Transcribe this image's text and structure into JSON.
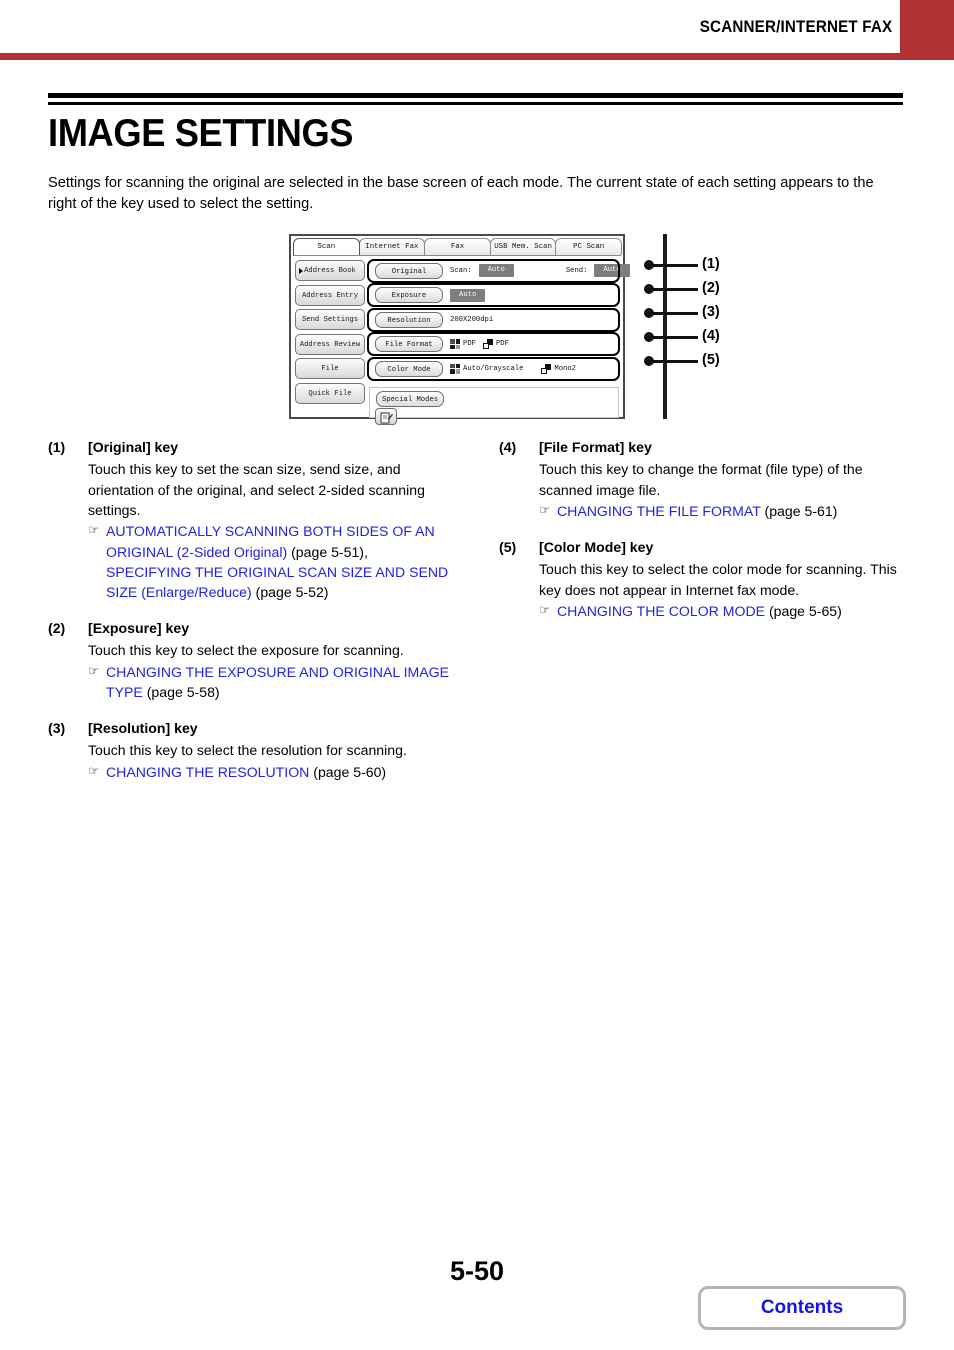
{
  "header": {
    "title": "SCANNER/INTERNET FAX",
    "accent_color": "#b03334"
  },
  "page": {
    "title": "IMAGE SETTINGS",
    "intro": "Settings for scanning the original are selected in the base screen of each mode. The current state of each setting appears to the right of the key used to select the setting.",
    "number": "5-50",
    "contents_label": "Contents",
    "link_color": "#2222e0"
  },
  "figure": {
    "tabs": [
      {
        "label": "Scan",
        "active": true
      },
      {
        "label": "Internet Fax",
        "active": false
      },
      {
        "label": "Fax",
        "active": false
      },
      {
        "label": "USB Mem. Scan",
        "active": false
      },
      {
        "label": "PC Scan",
        "active": false
      }
    ],
    "side_keys": [
      {
        "label": "Address Book",
        "selected": true
      },
      {
        "label": "Address Entry",
        "selected": false
      },
      {
        "label": "Send Settings",
        "selected": false
      },
      {
        "label": "Address Review",
        "selected": false
      },
      {
        "label": "File",
        "selected": false
      },
      {
        "label": "Quick File",
        "selected": false
      }
    ],
    "rows": {
      "original": {
        "key_label": "Original",
        "scan_label": "Scan:",
        "scan_value": "Auto",
        "send_label": "Send:",
        "send_value": "Auto"
      },
      "exposure": {
        "key_label": "Exposure",
        "value": "Auto"
      },
      "resolution": {
        "key_label": "Resolution",
        "value": "200X200dpi"
      },
      "file_format": {
        "key_label": "File Format",
        "color_value": "PDF",
        "mono_value": "PDF"
      },
      "color_mode": {
        "key_label": "Color Mode",
        "color_value": "Auto/Grayscale",
        "mono_value": "Mono2"
      }
    },
    "special_modes_label": "Special Modes",
    "doc_icon_name": "document-edit-icon",
    "callouts": [
      {
        "num": "(1)"
      },
      {
        "num": "(2)"
      },
      {
        "num": "(3)"
      },
      {
        "num": "(4)"
      },
      {
        "num": "(5)"
      }
    ]
  },
  "descriptions": {
    "left": [
      {
        "num": "(1)",
        "title": "[Original] key",
        "body": "Touch this key to set the scan size, send size, and orientation of the original, and select 2-sided scanning settings.",
        "xrefs": [
          {
            "hand": "☞",
            "parts": [
              {
                "text": "AUTOMATICALLY SCANNING BOTH SIDES OF AN ORIGINAL (2-Sided Original) ",
                "link": true
              },
              {
                "text": "(page 5-51), ",
                "link": false
              },
              {
                "text": "SPECIFYING THE ORIGINAL SCAN SIZE AND SEND SIZE (Enlarge/Reduce) ",
                "link": true
              },
              {
                "text": "(page 5-52)",
                "link": false
              }
            ]
          }
        ]
      },
      {
        "num": "(2)",
        "title": "[Exposure] key",
        "body": "Touch this key to select the exposure for scanning.",
        "xrefs": [
          {
            "hand": "☞",
            "parts": [
              {
                "text": "CHANGING THE EXPOSURE AND ORIGINAL IMAGE TYPE ",
                "link": true
              },
              {
                "text": "(page 5-58)",
                "link": false
              }
            ]
          }
        ]
      },
      {
        "num": "(3)",
        "title": "[Resolution] key",
        "body": "Touch this key to select the resolution for scanning.",
        "xrefs": [
          {
            "hand": "☞",
            "parts": [
              {
                "text": "CHANGING THE RESOLUTION ",
                "link": true
              },
              {
                "text": "(page 5-60)",
                "link": false
              }
            ]
          }
        ]
      }
    ],
    "right": [
      {
        "num": "(4)",
        "title": "[File Format] key",
        "body": "Touch this key to change the format (file type) of the scanned image file.",
        "xrefs": [
          {
            "hand": "☞",
            "parts": [
              {
                "text": "CHANGING THE FILE FORMAT ",
                "link": true
              },
              {
                "text": "(page 5-61)",
                "link": false
              }
            ]
          }
        ]
      },
      {
        "num": "(5)",
        "title": "[Color Mode] key",
        "body": "Touch this key to select the color mode for scanning. This key does not appear in Internet fax mode.",
        "xrefs": [
          {
            "hand": "☞",
            "parts": [
              {
                "text": "CHANGING THE COLOR MODE ",
                "link": true
              },
              {
                "text": "(page 5-65)",
                "link": false
              }
            ]
          }
        ]
      }
    ]
  }
}
